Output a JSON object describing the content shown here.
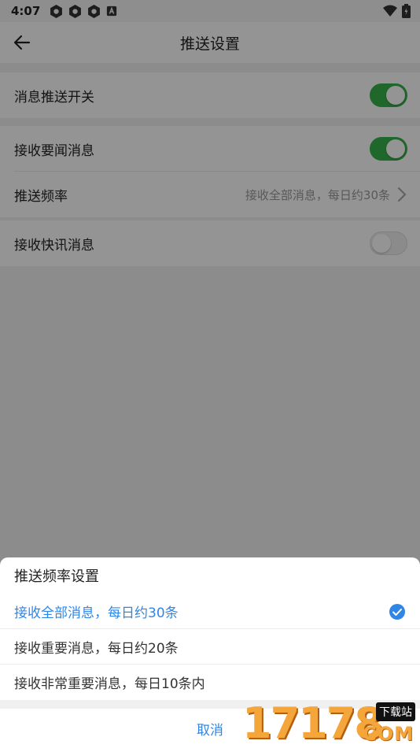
{
  "status_bar": {
    "time": "4:07",
    "icons": [
      "app-notification-icon",
      "app-notification-icon",
      "app-notification-icon",
      "font-a-icon"
    ],
    "right_icons": [
      "wifi-icon",
      "battery-icon"
    ]
  },
  "header": {
    "title": "推送设置",
    "back_icon": "arrow-left-icon"
  },
  "settings": {
    "push_switch": {
      "label": "消息推送开关",
      "on": true
    },
    "receive_headlines": {
      "label": "接收要闻消息",
      "on": true
    },
    "push_frequency": {
      "label": "推送频率",
      "value": "接收全部消息，每日约30条"
    },
    "receive_flash": {
      "label": "接收快讯消息",
      "on": false
    }
  },
  "sheet": {
    "title": "推送频率设置",
    "options": [
      {
        "label": "接收全部消息，每日约30条",
        "selected": true
      },
      {
        "label": "接收重要消息，每日约20条",
        "selected": false
      },
      {
        "label": "接收非常重要消息，每日10条内",
        "selected": false
      }
    ],
    "cancel_label": "取消"
  },
  "watermark": {
    "number": "17178",
    "tag": "下载站",
    "domain": "COM"
  },
  "colors": {
    "accent_blue": "#2f86e6",
    "toggle_green": "#36b24a",
    "scrim": "rgba(0,0,0,0.42)"
  }
}
